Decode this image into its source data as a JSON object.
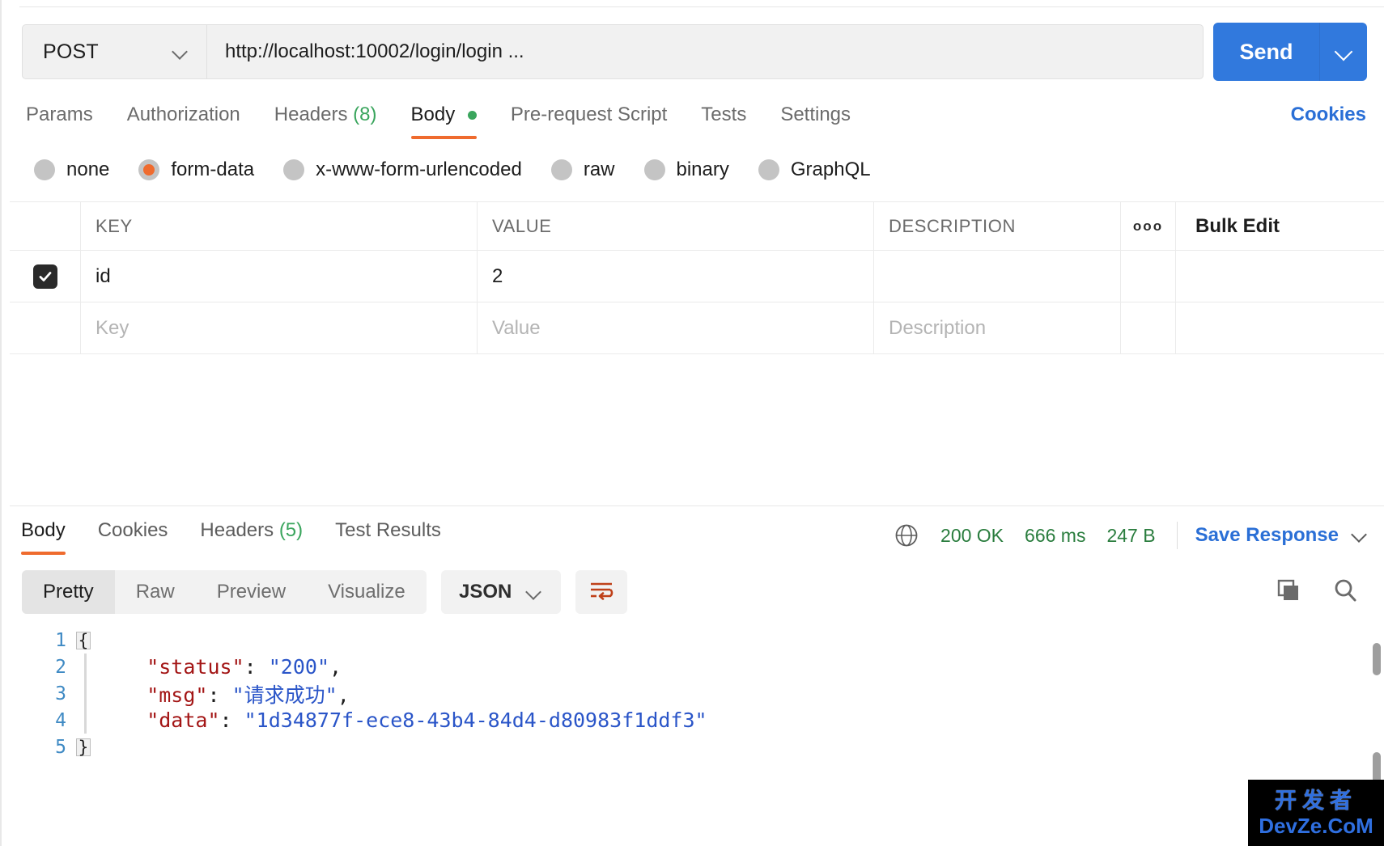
{
  "request": {
    "method": "POST",
    "url": "http://localhost:10002/login/login ...",
    "send_label": "Send",
    "tabs": [
      {
        "label": "Params",
        "count": "",
        "active": false,
        "dot": false
      },
      {
        "label": "Authorization",
        "count": "",
        "active": false,
        "dot": false
      },
      {
        "label": "Headers",
        "count": "(8)",
        "active": false,
        "dot": false
      },
      {
        "label": "Body",
        "count": "",
        "active": true,
        "dot": true
      },
      {
        "label": "Pre-request Script",
        "count": "",
        "active": false,
        "dot": false
      },
      {
        "label": "Tests",
        "count": "",
        "active": false,
        "dot": false
      },
      {
        "label": "Settings",
        "count": "",
        "active": false,
        "dot": false
      }
    ],
    "cookies_link": "Cookies",
    "body_types": [
      {
        "label": "none",
        "selected": false
      },
      {
        "label": "form-data",
        "selected": true
      },
      {
        "label": "x-www-form-urlencoded",
        "selected": false
      },
      {
        "label": "raw",
        "selected": false
      },
      {
        "label": "binary",
        "selected": false
      },
      {
        "label": "GraphQL",
        "selected": false
      }
    ],
    "table": {
      "headers": {
        "key": "KEY",
        "value": "VALUE",
        "description": "DESCRIPTION"
      },
      "options_icon": "ooo",
      "bulk_edit": "Bulk Edit",
      "rows": [
        {
          "checked": true,
          "key": "id",
          "value": "2",
          "description": ""
        }
      ],
      "placeholder_row": {
        "key": "Key",
        "value": "Value",
        "description": "Description"
      }
    }
  },
  "response": {
    "tabs": [
      {
        "label": "Body",
        "count": "",
        "active": true
      },
      {
        "label": "Cookies",
        "count": "",
        "active": false
      },
      {
        "label": "Headers",
        "count": "(5)",
        "active": false
      },
      {
        "label": "Test Results",
        "count": "",
        "active": false
      }
    ],
    "meta": {
      "status": "200 OK",
      "time": "666 ms",
      "size": "247 B"
    },
    "save_response": "Save Response",
    "viewer": {
      "modes": [
        {
          "label": "Pretty",
          "active": true
        },
        {
          "label": "Raw",
          "active": false
        },
        {
          "label": "Preview",
          "active": false
        },
        {
          "label": "Visualize",
          "active": false
        }
      ],
      "format": "JSON",
      "wrap_icon": "wrap-lines-icon",
      "copy_icon": "copy-icon",
      "search_icon": "search-icon"
    },
    "code": {
      "lines": [
        {
          "n": "1",
          "fold": "{",
          "text": ""
        },
        {
          "n": "2",
          "fold": "",
          "text": "    \"status\": \"200\","
        },
        {
          "n": "3",
          "fold": "",
          "text": "    \"msg\": \"请求成功\","
        },
        {
          "n": "4",
          "fold": "",
          "text": "    \"data\": \"1d34877f-ece8-43b4-84d4-d80983f1ddf3\""
        },
        {
          "n": "5",
          "fold": "}",
          "text": ""
        }
      ],
      "body_json": {
        "status": "200",
        "msg": "请求成功",
        "data": "1d34877f-ece8-43b4-84d4-d80983f1ddf3"
      }
    }
  },
  "watermark": {
    "cn": "开发者",
    "en": "DevZe.CoM"
  },
  "colors": {
    "accent_orange": "#ef6b2e",
    "send_blue": "#3179dd",
    "link_blue": "#2a6fd6",
    "status_green": "#2a7d3e",
    "json_key": "#a31515",
    "json_string": "#2a55c8"
  }
}
